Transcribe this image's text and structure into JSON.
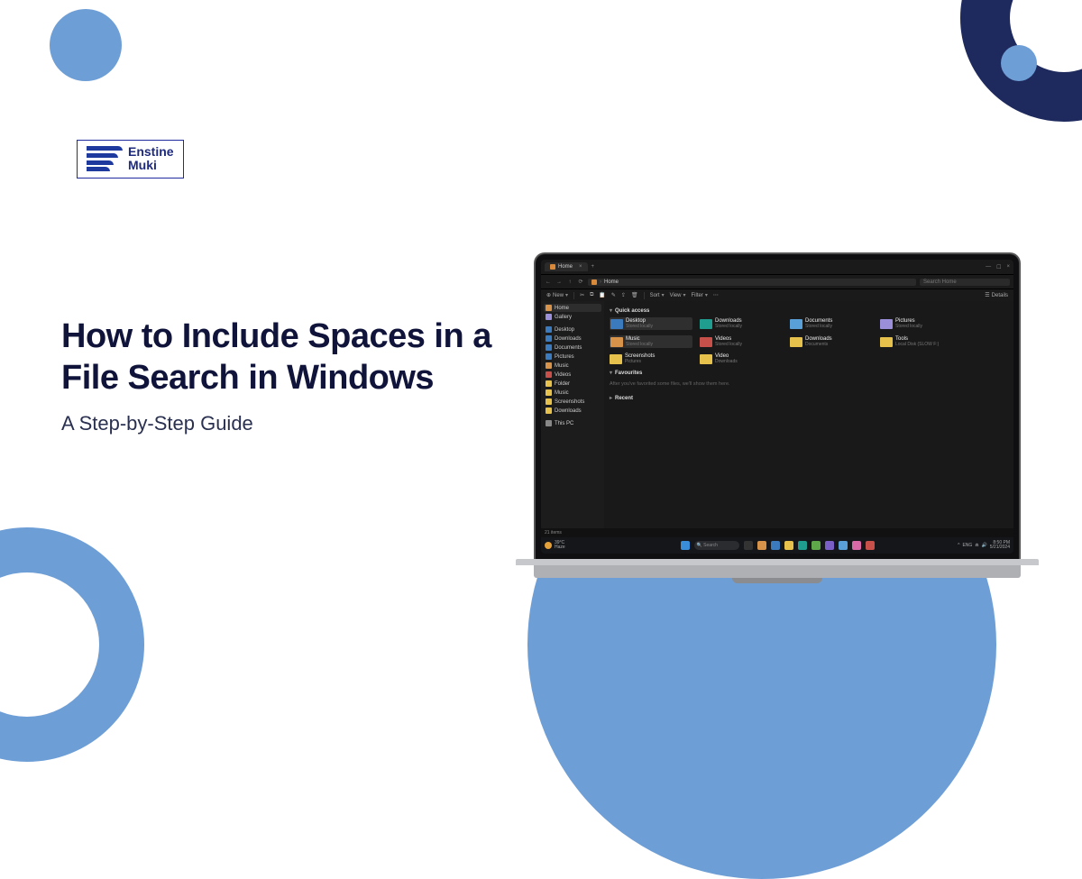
{
  "logo": {
    "line1": "Enstine",
    "line2": "Muki"
  },
  "headline": {
    "title": "How to Include Spaces in a File Search in Windows",
    "subtitle": "A Step-by-Step Guide"
  },
  "explorer": {
    "tab_label": "Home",
    "address_label": "Home",
    "search_placeholder": "Search Home",
    "toolbar": {
      "new": "New",
      "sort": "Sort",
      "view": "View",
      "filter": "Filter",
      "details": "Details"
    },
    "sidebar": [
      {
        "label": "Home",
        "color": "c-orange",
        "active": true
      },
      {
        "label": "Gallery",
        "color": "c-lav"
      },
      {
        "sep": true
      },
      {
        "label": "Desktop",
        "color": "c-blue"
      },
      {
        "label": "Downloads",
        "color": "c-blue"
      },
      {
        "label": "Documents",
        "color": "c-blue"
      },
      {
        "label": "Pictures",
        "color": "c-blue"
      },
      {
        "label": "Music",
        "color": "c-orange"
      },
      {
        "label": "Videos",
        "color": "c-red"
      },
      {
        "label": "Folder",
        "color": "c-yellow"
      },
      {
        "label": "Music",
        "color": "c-yellow"
      },
      {
        "label": "Screenshots",
        "color": "c-yellow"
      },
      {
        "label": "Downloads",
        "color": "c-yellow"
      },
      {
        "sep": true
      },
      {
        "label": "This PC",
        "color": "c-gray"
      }
    ],
    "sections": {
      "quick_access": "Quick access",
      "favourites": "Favourites",
      "favourites_empty": "After you've favorited some files, we'll show them here.",
      "recent": "Recent"
    },
    "quick_items_row1": [
      {
        "name": "Desktop",
        "sub": "Stored locally",
        "color": "c-blue",
        "sel": true
      },
      {
        "name": "Downloads",
        "sub": "Stored locally",
        "color": "c-teal"
      },
      {
        "name": "Documents",
        "sub": "Stored locally",
        "color": "c-lightblue"
      },
      {
        "name": "Pictures",
        "sub": "Stored locally",
        "color": "c-lav"
      }
    ],
    "quick_items_row2": [
      {
        "name": "Music",
        "sub": "Stored locally",
        "color": "c-orange",
        "sel": true
      },
      {
        "name": "Videos",
        "sub": "Stored locally",
        "color": "c-red"
      },
      {
        "name": "Downloads",
        "sub": "Documents",
        "color": "c-yellow"
      },
      {
        "name": "Tools",
        "sub": "Local Disk (SLOW F:)",
        "color": "c-yellow"
      }
    ],
    "quick_items_row3": [
      {
        "name": "Screenshots",
        "sub": "Pictures",
        "color": "c-yellow"
      },
      {
        "name": "Video",
        "sub": "Downloads",
        "color": "c-yellow"
      }
    ],
    "statusbar": "21 items",
    "weather": {
      "temp": "39°C",
      "cond": "Haze"
    },
    "clock": {
      "time": "8:50 PM",
      "date": "5/21/2024"
    }
  }
}
